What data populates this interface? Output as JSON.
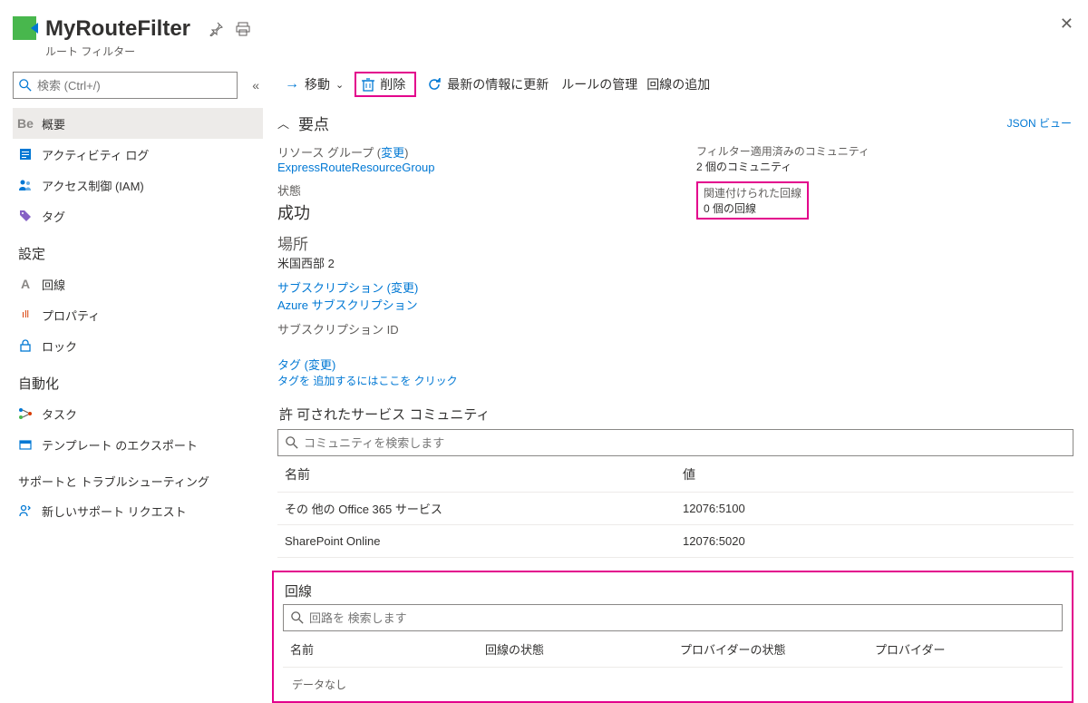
{
  "header": {
    "title": "MyRouteFilter",
    "subtitle": "ルート フィルター"
  },
  "search": {
    "placeholder": "検索 (Ctrl+/)"
  },
  "nav": {
    "overview": "概要",
    "activity": "アクティビティ ログ",
    "iam": "アクセス制御 (IAM)",
    "tags": "タグ",
    "settings_section": "設定",
    "circuits": "回線",
    "properties": "プロパティ",
    "locks": "ロック",
    "automation_section": "自動化",
    "tasks": "タスク",
    "export": "テンプレート のエクスポート",
    "support_section": "サポートと トラブルシューティング",
    "new_support": "新しいサポート リクエスト"
  },
  "toolbar": {
    "move": "移動",
    "delete": "削除",
    "refresh": "最新の情報に更新",
    "manage_rule": "ルールの管理",
    "add_circuit": "回線の追加"
  },
  "essentials": {
    "title": "要点",
    "json_view": "JSON ビュー",
    "rg_label": "リソース グループ (",
    "change": "変更",
    "rg_value": "ExpressRouteResourceGroup",
    "status_label": "状態",
    "status_value": "成功",
    "location_label": "場所",
    "location_value": "米国西部 2",
    "sub_label": "サブスクリプション (",
    "sub_value": "Azure サブスクリプション",
    "sub_id_label": "サブスクリプション ID",
    "communities_label": "フィルター適用済みのコミュニティ",
    "communities_value": "2 個のコミュニティ",
    "related_label": "関連付けられた回線",
    "related_value": "0 個の回線",
    "tags_label": "タグ (",
    "tags_hint": "タグを 追加するにはここを クリック"
  },
  "communities": {
    "title": "許 可されたサービス コミュニティ",
    "search_placeholder": "コミュニティを検索します",
    "col_name": "名前",
    "col_value": "値",
    "rows": [
      {
        "name": "その 他の Office 365 サービス",
        "value": "12076:5100"
      },
      {
        "name": "SharePoint Online",
        "value": "12076:5020"
      }
    ]
  },
  "circuits": {
    "title": "回線",
    "search_placeholder": "回路を 検索します",
    "col_name": "名前",
    "col_state": "回線の状態",
    "col_prov_state": "プロバイダーの状態",
    "col_provider": "プロバイダー",
    "no_data": "データなし"
  }
}
